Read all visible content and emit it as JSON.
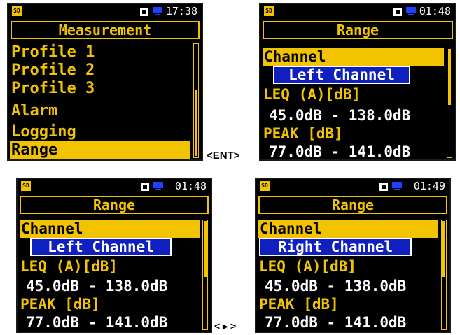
{
  "screen1": {
    "time": "17:38",
    "title": "Measurement",
    "items": [
      "Profile 1",
      "Profile 2",
      "Profile 3",
      "Alarm",
      "Logging",
      "Range"
    ],
    "selected": "Range"
  },
  "screen2": {
    "time": "01:48",
    "title": "Range",
    "channel_label": "Channel",
    "channel_value": "Left Channel",
    "leq_label": "LEQ (A)[dB]",
    "leq_value": "45.0dB - 138.0dB",
    "peak_label": "PEAK [dB]",
    "peak_value": "77.0dB - 141.0dB"
  },
  "screen3": {
    "time": "01:48",
    "title": "Range",
    "channel_label": "Channel",
    "channel_value": "Left Channel",
    "leq_label": "LEQ (A)[dB]",
    "leq_value": "45.0dB - 138.0dB",
    "peak_label": "PEAK [dB]",
    "peak_value": "77.0dB - 141.0dB"
  },
  "screen4": {
    "time": "01:49",
    "title": "Range",
    "channel_label": "Channel",
    "channel_value": "Right Channel",
    "leq_label": "LEQ (A)[dB]",
    "leq_value": "45.0dB - 138.0dB",
    "peak_label": "PEAK [dB]",
    "peak_value": "77.0dB - 141.0dB"
  },
  "annotations": {
    "enter_key": "<ENT>",
    "left_right_keys": "< ▸ >"
  },
  "status_icons": {
    "sd": "SD",
    "square": "square-icon",
    "monitor": "monitor-icon"
  },
  "colors": {
    "accent": "#f2c400",
    "highlight": "#1020c0",
    "background": "#000000",
    "text": "#ffffff"
  }
}
